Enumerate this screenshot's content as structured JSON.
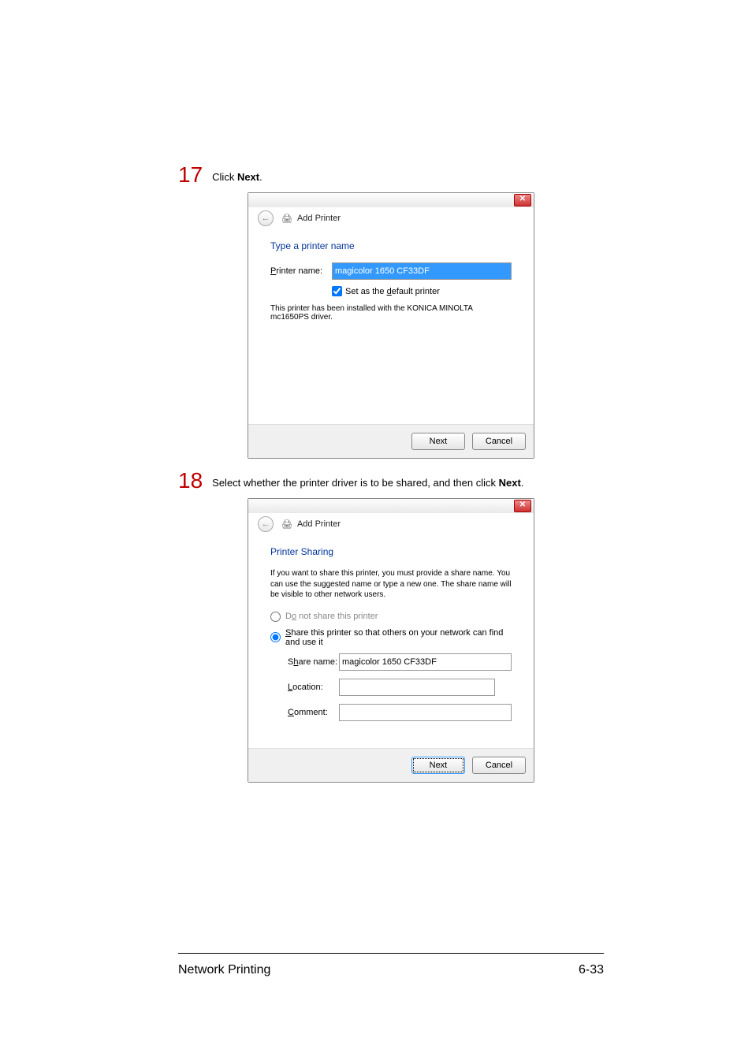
{
  "step17": {
    "num": "17",
    "text_pre": "Click ",
    "text_bold": "Next",
    "text_post": "."
  },
  "step18": {
    "num": "18",
    "text_pre": "Select whether the printer driver is to be shared, and then click ",
    "text_bold": "Next",
    "text_post": "."
  },
  "wiz1": {
    "close_glyph": "✕",
    "back_glyph": "←",
    "printer_glyph": "🖨",
    "breadcrumb": "Add Printer",
    "heading": "Type a printer name",
    "name_label": "Printer name:",
    "name_value": "magicolor 1650 CF33DF",
    "checkbox_label_pre": "Set as the ",
    "checkbox_label_ul": "d",
    "checkbox_label_post": "efault printer",
    "checkbox_checked": true,
    "note": "This printer has been installed with the KONICA MINOLTA mc1650PS driver.",
    "btn_next": "Next",
    "btn_cancel": "Cancel"
  },
  "wiz2": {
    "close_glyph": "✕",
    "back_glyph": "←",
    "printer_glyph": "🖨",
    "breadcrumb": "Add Printer",
    "heading": "Printer Sharing",
    "desc": "If you want to share this printer, you must provide a share name. You can use the suggested name or type a new one. The share name will be visible to other network users.",
    "radio_no_pre": "D",
    "radio_no_ul": "o",
    "radio_no_post": " not share this printer",
    "radio_yes_ul": "S",
    "radio_yes_post": "hare this printer so that others on your network can find and use it",
    "share_checked": "yes",
    "sharename_lbl_pre": "S",
    "sharename_lbl_ul": "h",
    "sharename_lbl_post": "are name:",
    "sharename_val": "magicolor 1650 CF33DF",
    "location_lbl_ul": "L",
    "location_lbl_post": "ocation:",
    "location_val": "",
    "comment_lbl_ul": "C",
    "comment_lbl_post": "omment:",
    "comment_val": "",
    "btn_next": "Next",
    "btn_cancel": "Cancel"
  },
  "footer": {
    "left": "Network Printing",
    "right": "6-33"
  }
}
